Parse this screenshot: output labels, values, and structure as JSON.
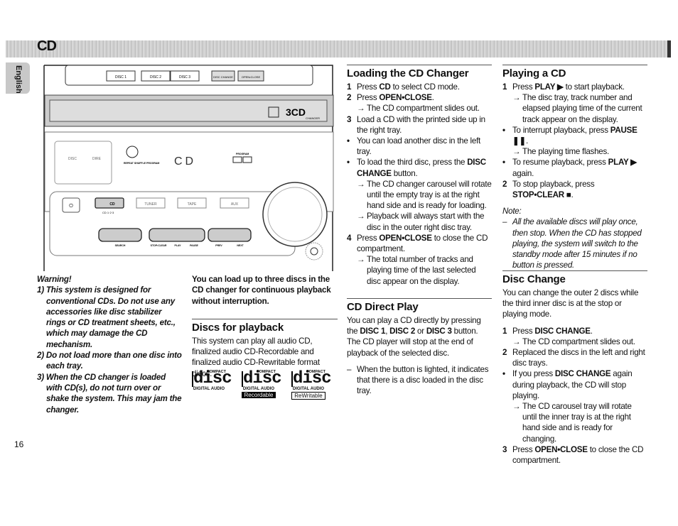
{
  "header": {
    "title": "CD",
    "language_tab": "English"
  },
  "device": {
    "top_buttons": [
      "DISC 1",
      "DISC 2",
      "DISC 3",
      "DISC CHANGE",
      "OPEN•CLOSE"
    ],
    "badge": "3CD",
    "badge_sub": "CHANGER",
    "display": "CD",
    "display_labels": [
      "REPEAT SHUFFLE PROGRAM",
      "PROGRAM"
    ],
    "source_buttons": [
      "CD",
      "TUNER",
      "TAPE",
      "AUX"
    ],
    "source_sub": [
      "CD 1·2·3"
    ],
    "transport_labels": [
      "SEARCH",
      "STOP•CLEAR",
      "PLAY",
      "PAUSE",
      "PREV",
      "NEXT"
    ],
    "dsc_buttons": [
      "DISC",
      "DIRE"
    ],
    "volume": "VOLUME"
  },
  "warning": {
    "title": "Warning!",
    "items": [
      "1) This system is designed for conventional CDs. Do not use any accessories like disc stabilizer rings or CD treatment sheets, etc., which may damage the CD mechanism.",
      "2) Do not load more than one disc into each tray.",
      "3) When the CD changer is loaded with CD(s), do not turn over or shake the system. This may jam the changer."
    ]
  },
  "lead": "You can load up to three discs in the CD changer for continuous playback without interruption.",
  "discs": {
    "title": "Discs for playback",
    "text": "This system can play all audio CD, finalized audio CD-Recordable and finalized audio CD-Rewritable format discs.",
    "logos": [
      {
        "top": "COMPACT",
        "word": "disc",
        "sub": "DIGITAL AUDIO",
        "tag": ""
      },
      {
        "top": "COMPACT",
        "word": "disc",
        "sub": "DIGITAL AUDIO",
        "tag": "Recordable"
      },
      {
        "top": "COMPACT",
        "word": "disc",
        "sub": "DIGITAL AUDIO",
        "tag": "ReWritable"
      }
    ]
  },
  "loading": {
    "title": "Loading the CD Changer",
    "items": [
      {
        "k": "num",
        "m": "1",
        "parts": [
          [
            "t",
            "Press "
          ],
          [
            "b",
            "CD"
          ],
          [
            "t",
            " to select CD mode."
          ]
        ]
      },
      {
        "k": "num",
        "m": "2",
        "parts": [
          [
            "t",
            "Press "
          ],
          [
            "b",
            "OPEN•CLOSE"
          ],
          [
            "t",
            "."
          ]
        ]
      },
      {
        "k": "arrow",
        "m": "→",
        "parts": [
          [
            "t",
            "The CD compartment slides out."
          ]
        ]
      },
      {
        "k": "num",
        "m": "3",
        "parts": [
          [
            "t",
            "Load a CD with the printed side up in the right tray."
          ]
        ]
      },
      {
        "k": "bullet",
        "m": "•",
        "parts": [
          [
            "t",
            "You can load another disc in the left tray."
          ]
        ]
      },
      {
        "k": "bullet",
        "m": "•",
        "parts": [
          [
            "t",
            "To load the third disc, press the "
          ],
          [
            "b",
            "DISC CHANGE"
          ],
          [
            "t",
            " button."
          ]
        ]
      },
      {
        "k": "arrow",
        "m": "→",
        "parts": [
          [
            "t",
            "The CD changer carousel will rotate until the empty tray is at the right hand side and is ready for loading."
          ]
        ]
      },
      {
        "k": "arrow",
        "m": "→",
        "parts": [
          [
            "t",
            "Playback will always start with the disc in the outer right disc tray."
          ]
        ]
      },
      {
        "k": "num",
        "m": "4",
        "parts": [
          [
            "t",
            "Press "
          ],
          [
            "b",
            "OPEN•CLOSE"
          ],
          [
            "t",
            " to close the CD compartment."
          ]
        ]
      },
      {
        "k": "arrow",
        "m": "→",
        "parts": [
          [
            "t",
            "The total number of tracks and playing time of the last selected disc appear on the display."
          ]
        ]
      }
    ]
  },
  "direct": {
    "title": "CD Direct Play",
    "items": [
      {
        "k": "text",
        "parts": [
          [
            "t",
            "You can play a CD directly by pressing the "
          ],
          [
            "b",
            "DISC 1"
          ],
          [
            "t",
            ", "
          ],
          [
            "b",
            "DISC 2"
          ],
          [
            "t",
            " or "
          ],
          [
            "b",
            "DISC 3"
          ],
          [
            "t",
            " button. The CD player will stop at the end of playback of the selected disc."
          ]
        ]
      },
      {
        "k": "gap"
      },
      {
        "k": "dash",
        "m": "–",
        "parts": [
          [
            "t",
            "When the button is lighted, it indicates that there is a disc loaded in the disc tray."
          ]
        ]
      }
    ]
  },
  "playing": {
    "title": "Playing a CD",
    "items": [
      {
        "k": "num",
        "m": "1",
        "parts": [
          [
            "t",
            "Press "
          ],
          [
            "b",
            "PLAY ▶"
          ],
          [
            "t",
            " to start playback."
          ]
        ]
      },
      {
        "k": "arrow",
        "m": "→",
        "parts": [
          [
            "t",
            "The disc tray, track number and elapsed playing time of the current track appear on the display."
          ]
        ]
      },
      {
        "k": "bullet",
        "m": "•",
        "parts": [
          [
            "t",
            "To interrupt playback, press "
          ],
          [
            "b",
            "PAUSE ❚❚"
          ],
          [
            "t",
            "."
          ]
        ]
      },
      {
        "k": "arrow",
        "m": "→",
        "parts": [
          [
            "t",
            "The playing time flashes."
          ]
        ]
      },
      {
        "k": "bullet",
        "m": "•",
        "parts": [
          [
            "t",
            "To resume playback, press "
          ],
          [
            "b",
            "PLAY ▶"
          ],
          [
            "t",
            " again."
          ]
        ]
      },
      {
        "k": "num",
        "m": "2",
        "parts": [
          [
            "t",
            "To stop playback, press "
          ],
          [
            "b",
            "STOP•CLEAR ■"
          ],
          [
            "t",
            "."
          ]
        ]
      },
      {
        "k": "gap"
      },
      {
        "k": "note",
        "parts": [
          [
            "t",
            "Note:"
          ]
        ]
      },
      {
        "k": "dash",
        "m": "–",
        "note": true,
        "parts": [
          [
            "t",
            "All the available discs will play once, then stop. When the CD has stopped playing, the system will switch to the standby mode after 15 minutes if no button is pressed."
          ]
        ]
      }
    ]
  },
  "change": {
    "title": "Disc Change",
    "items": [
      {
        "k": "text",
        "parts": [
          [
            "t",
            "You can change the outer 2 discs while the third inner disc is at the stop or playing mode."
          ]
        ]
      },
      {
        "k": "gap"
      },
      {
        "k": "num",
        "m": "1",
        "parts": [
          [
            "t",
            "Press "
          ],
          [
            "b",
            "DISC CHANGE"
          ],
          [
            "t",
            "."
          ]
        ]
      },
      {
        "k": "arrow",
        "m": "→",
        "parts": [
          [
            "t",
            "The CD compartment slides out."
          ]
        ]
      },
      {
        "k": "num",
        "m": "2",
        "parts": [
          [
            "t",
            "Replaced the discs in the left and right disc trays."
          ]
        ]
      },
      {
        "k": "bullet",
        "m": "•",
        "parts": [
          [
            "t",
            "If you press "
          ],
          [
            "b",
            "DISC CHANGE"
          ],
          [
            "t",
            " again during playback, the CD will stop playing."
          ]
        ]
      },
      {
        "k": "arrow",
        "m": "→",
        "parts": [
          [
            "t",
            "The CD carousel tray will rotate until the inner tray is at the right hand side and is ready for changing."
          ]
        ]
      },
      {
        "k": "num",
        "m": "3",
        "parts": [
          [
            "t",
            "Press "
          ],
          [
            "b",
            "OPEN•CLOSE"
          ],
          [
            "t",
            " to close the CD compartment."
          ]
        ]
      }
    ]
  },
  "page_number": "16"
}
